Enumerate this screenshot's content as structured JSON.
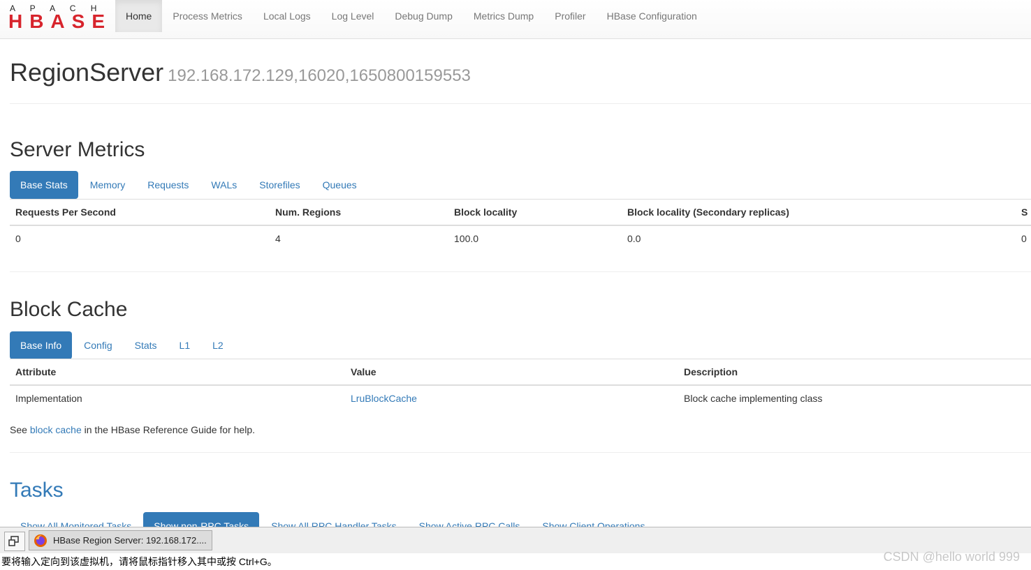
{
  "logo": {
    "top": "A P A C H E",
    "main": "HBASE"
  },
  "nav": [
    "Home",
    "Process Metrics",
    "Local Logs",
    "Log Level",
    "Debug Dump",
    "Metrics Dump",
    "Profiler",
    "HBase Configuration"
  ],
  "page": {
    "title": "RegionServer",
    "server": "192.168.172.129,16020,1650800159553"
  },
  "server_metrics": {
    "title": "Server Metrics",
    "tabs": [
      "Base Stats",
      "Memory",
      "Requests",
      "WALs",
      "Storefiles",
      "Queues"
    ],
    "columns": [
      "Requests Per Second",
      "Num. Regions",
      "Block locality",
      "Block locality (Secondary replicas)",
      "S"
    ],
    "row": [
      "0",
      "4",
      "100.0",
      "0.0",
      "0"
    ]
  },
  "block_cache": {
    "title": "Block Cache",
    "tabs": [
      "Base Info",
      "Config",
      "Stats",
      "L1",
      "L2"
    ],
    "columns": [
      "Attribute",
      "Value",
      "Description"
    ],
    "row": [
      "Implementation",
      "LruBlockCache",
      "Block cache implementing class"
    ],
    "help": {
      "before": "See ",
      "link": "block cache",
      "after": " in the HBase Reference Guide for help."
    }
  },
  "tasks": {
    "title": "Tasks",
    "tabs": [
      "Show All Monitored Tasks",
      "Show non-RPC Tasks",
      "Show All RPC Handler Tasks",
      "Show Active RPC Calls",
      "Show Client Operations"
    ]
  },
  "taskbar": {
    "window_title": "HBase Region Server: 192.168.172...."
  },
  "status_message": "要将输入定向到该虚拟机，请将鼠标指针移入其中或按 Ctrl+G。",
  "watermark": "CSDN @hello world 999",
  "colors": {
    "accent": "#337ab7",
    "logo_red": "#d7242c"
  }
}
